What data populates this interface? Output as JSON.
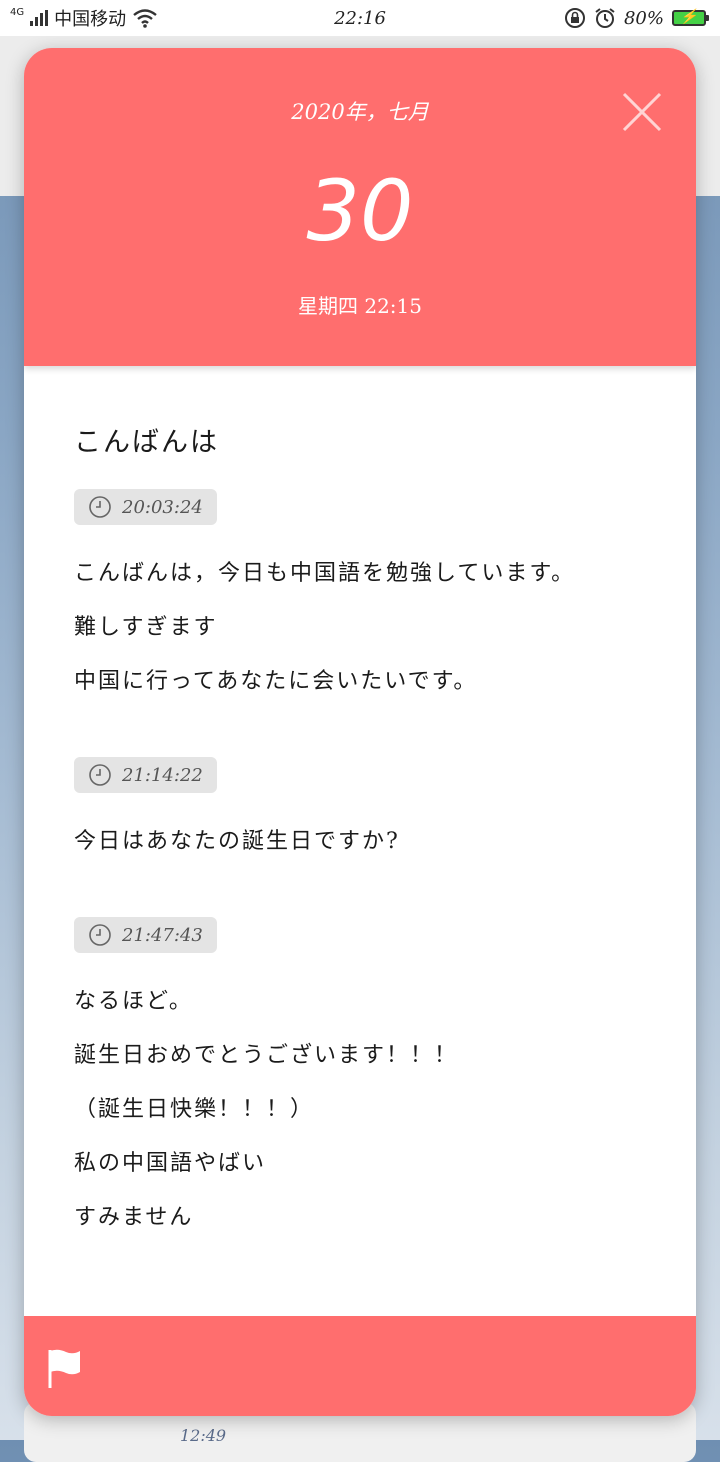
{
  "status_bar": {
    "network": "4G",
    "carrier": "中国移动",
    "time": "22:16",
    "battery": "80%",
    "icons": [
      "wifi-icon",
      "rotation-lock-icon",
      "alarm-icon",
      "battery-charging-icon"
    ]
  },
  "background": {
    "card_time": "12:49"
  },
  "dialog": {
    "header": {
      "year_month": "2020年，七月",
      "day": "30",
      "weekday_time": "星期四 22:15",
      "close_icon": "close-icon"
    },
    "title": "こんばんは",
    "entries": [
      {
        "time": "20:03:24",
        "lines": [
          "こんばんは，今日も中国語を勉強しています。",
          "難しすぎます",
          "中国に行ってあなたに会いたいです。"
        ]
      },
      {
        "time": "21:14:22",
        "lines": [
          "今日はあなたの誕生日ですか?"
        ]
      },
      {
        "time": "21:47:43",
        "lines": [
          "なるほど。",
          "誕生日おめでとうございます！！！",
          "（誕生日快樂！！！）",
          "私の中国語やばい",
          "すみません"
        ]
      }
    ],
    "footer": {
      "flag_icon": "flag-icon"
    }
  },
  "colors": {
    "accent": "#ff6e6e",
    "chip_bg": "#e4e4e4",
    "battery_fill": "#45d146"
  }
}
